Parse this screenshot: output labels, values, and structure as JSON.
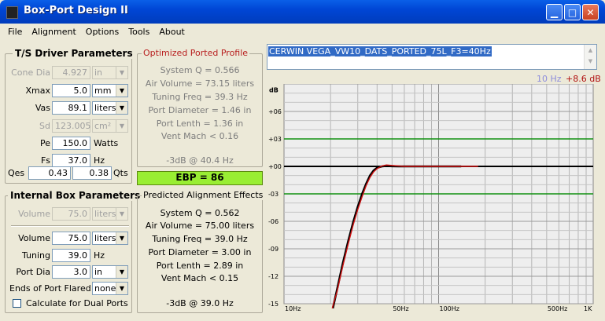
{
  "window": {
    "title": "Box-Port Design II"
  },
  "menu": [
    "File",
    "Alignment",
    "Options",
    "Tools",
    "About"
  ],
  "ts_params": {
    "title": "T/S Driver Parameters",
    "cone_dia": {
      "label": "Cone Dia",
      "value": "4.927",
      "unit": "in"
    },
    "xmax": {
      "label": "Xmax",
      "value": "5.0",
      "unit": "mm"
    },
    "vas": {
      "label": "Vas",
      "value": "89.1",
      "unit": "liters"
    },
    "sd": {
      "label": "Sd",
      "value": "123.005",
      "unit": "cm²"
    },
    "pe": {
      "label": "Pe",
      "value": "150.0",
      "unit": "Watts"
    },
    "fs": {
      "label": "Fs",
      "value": "37.0",
      "unit": "Hz"
    },
    "qes": {
      "label": "Qes",
      "value": "0.43"
    },
    "qts": {
      "label": "Qts",
      "value": "0.38"
    }
  },
  "optimized": {
    "title": "Optimized Ported Profile",
    "lines": [
      "System Q = 0.566",
      "Air Volume = 73.15 liters",
      "Tuning Freq = 39.3 Hz",
      "Port Diameter = 1.46 in",
      "Port Lenth = 1.36 in",
      "Vent Mach < 0.16"
    ],
    "f3": "-3dB @ 40.4 Hz"
  },
  "ebp": "EBP = 86",
  "box_params": {
    "title": "Internal Box Parameters",
    "volume_top": {
      "label": "Volume",
      "value": "75.0",
      "unit": "liters"
    },
    "volume": {
      "label": "Volume",
      "value": "75.0",
      "unit": "liters"
    },
    "tuning": {
      "label": "Tuning",
      "value": "39.0",
      "unit": "Hz"
    },
    "port_dia": {
      "label": "Port Dia",
      "value": "3.0",
      "unit": "in"
    },
    "ends": {
      "label": "Ends of Port Flared",
      "value": "none"
    },
    "dual": "Calculate for Dual Ports"
  },
  "predicted": {
    "title": "Predicted Alignment Effects",
    "lines": [
      "System Q = 0.562",
      "Air Volume = 75.00 liters",
      "Tuning Freq = 39.0 Hz",
      "Port Diameter = 3.00 in",
      "Port Lenth = 2.89 in",
      "Vent Mach < 0.15"
    ],
    "f3": "-3dB @ 39.0 Hz"
  },
  "log": {
    "selected": "CERWIN VEGA_VW10_DATS_PORTED_75L_F3=40Hz"
  },
  "graph_readout": {
    "freq": "10 Hz",
    "db": "+8.6 dB"
  },
  "colors": {
    "readout_freq": "#8c8cdc",
    "readout_db": "#b01010",
    "green_lines": "#109010",
    "ebp_bg": "#99ee33"
  },
  "chart_data": {
    "type": "line",
    "xscale": "log",
    "xlim": [
      10,
      1000
    ],
    "ylim": [
      -15,
      9
    ],
    "ylabel": "dB",
    "ytick_labels": [
      "+06",
      "+03",
      "+00",
      "-03",
      "-06",
      "-09",
      "-12",
      "-15"
    ],
    "ytick_values": [
      6,
      3,
      0,
      -3,
      -6,
      -9,
      -12,
      -15
    ],
    "xtick_labels": [
      "10Hz",
      "50Hz",
      "100Hz",
      "500Hz",
      "1K"
    ],
    "xtick_values": [
      10,
      50,
      100,
      500,
      1000
    ],
    "reference_lines": [
      3,
      -3
    ],
    "series": [
      {
        "color": "#000000",
        "x": [
          20.7,
          22,
          24,
          26,
          28,
          30,
          32,
          34,
          36,
          38,
          40,
          43,
          46,
          50,
          55,
          60,
          70,
          80,
          100,
          140
        ],
        "y": [
          -15.5,
          -13.5,
          -10.6,
          -8.2,
          -6.1,
          -4.4,
          -3.0,
          -1.9,
          -1.0,
          -0.45,
          -0.15,
          0.0,
          0.05,
          0.02,
          0.0,
          0.0,
          0.0,
          0.0,
          0.0,
          0.0
        ]
      },
      {
        "color": "#d01010",
        "x": [
          20.5,
          22,
          24,
          26,
          28,
          30,
          32,
          34,
          36,
          38,
          40,
          43,
          46,
          50,
          55,
          60,
          70,
          80,
          100,
          140,
          180
        ],
        "y": [
          -15.5,
          -13.7,
          -10.9,
          -8.5,
          -6.4,
          -4.7,
          -3.3,
          -2.1,
          -1.2,
          -0.6,
          -0.25,
          0.05,
          0.15,
          0.1,
          0.05,
          0.0,
          0.0,
          0.0,
          0.0,
          0.0,
          0.0
        ]
      }
    ]
  }
}
